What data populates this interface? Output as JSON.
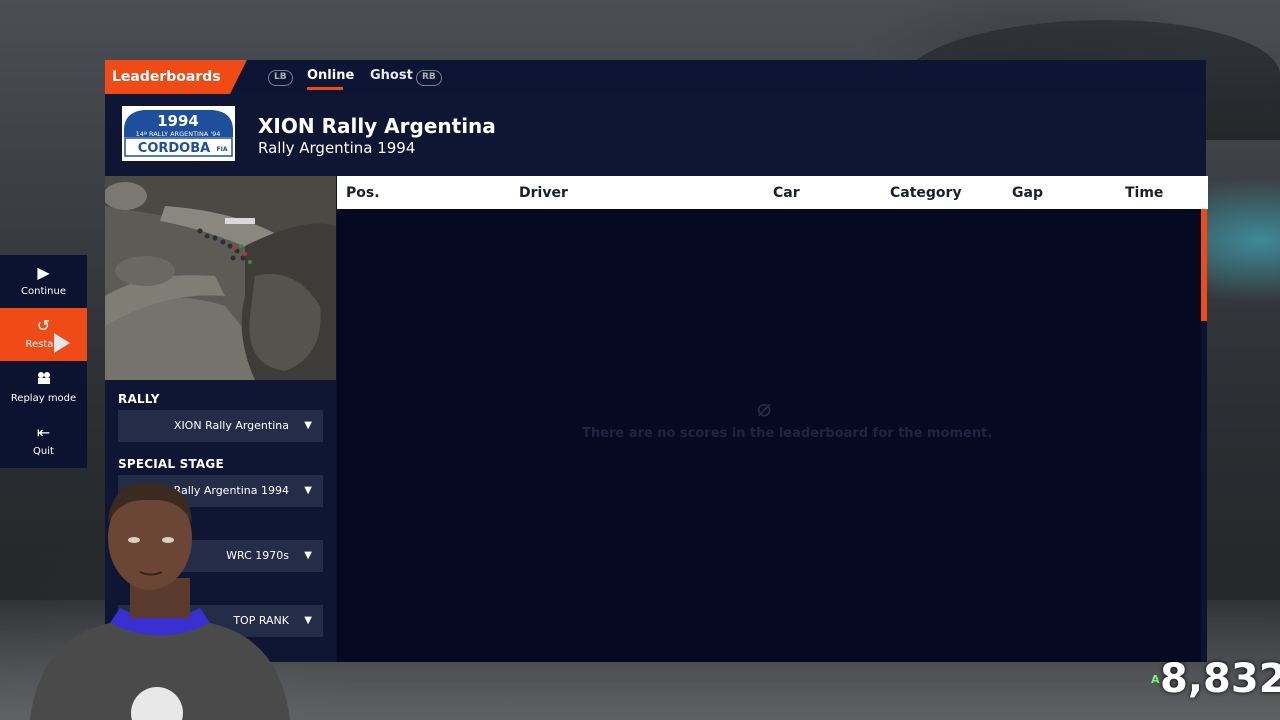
{
  "leaderboards": {
    "title": "Leaderboards",
    "lb_button": "LB",
    "rb_button": "RB",
    "tabs": [
      {
        "label": "Online",
        "active": true
      },
      {
        "label": "Ghost",
        "active": false
      }
    ]
  },
  "header": {
    "logo": {
      "year": "1994",
      "edition": "14ª RALLY ARGENTINA '94",
      "city": "CORDOBA",
      "badge": "FIA"
    },
    "rally_name": "XION Rally Argentina",
    "rally_subtitle": "Rally Argentina 1994"
  },
  "filters": {
    "rally": {
      "label": "RALLY",
      "value": "XION Rally Argentina"
    },
    "special_stage": {
      "label": "SPECIAL STAGE",
      "value": "Rally Argentina 1994"
    },
    "category": {
      "value": "WRC 1970s"
    },
    "rank": {
      "value": "TOP RANK"
    }
  },
  "table": {
    "columns": [
      "Pos.",
      "Driver",
      "Car",
      "Category",
      "Gap",
      "Time"
    ],
    "rows": [],
    "empty_message": "There are no scores in the leaderboard for the moment."
  },
  "side_menu": {
    "items": [
      {
        "label": "Continue",
        "icon": "play-icon",
        "active": false
      },
      {
        "label": "Restart",
        "icon": "restart-icon",
        "active": true
      },
      {
        "label": "Replay mode",
        "icon": "camera-icon",
        "active": false
      },
      {
        "label": "Quit",
        "icon": "exit-icon",
        "active": false
      }
    ]
  },
  "overlay": {
    "score": "8,832",
    "score_prefix": "A"
  },
  "colors": {
    "accent": "#f04a16",
    "panel": "#0b1230",
    "table_body": "#050a22"
  }
}
